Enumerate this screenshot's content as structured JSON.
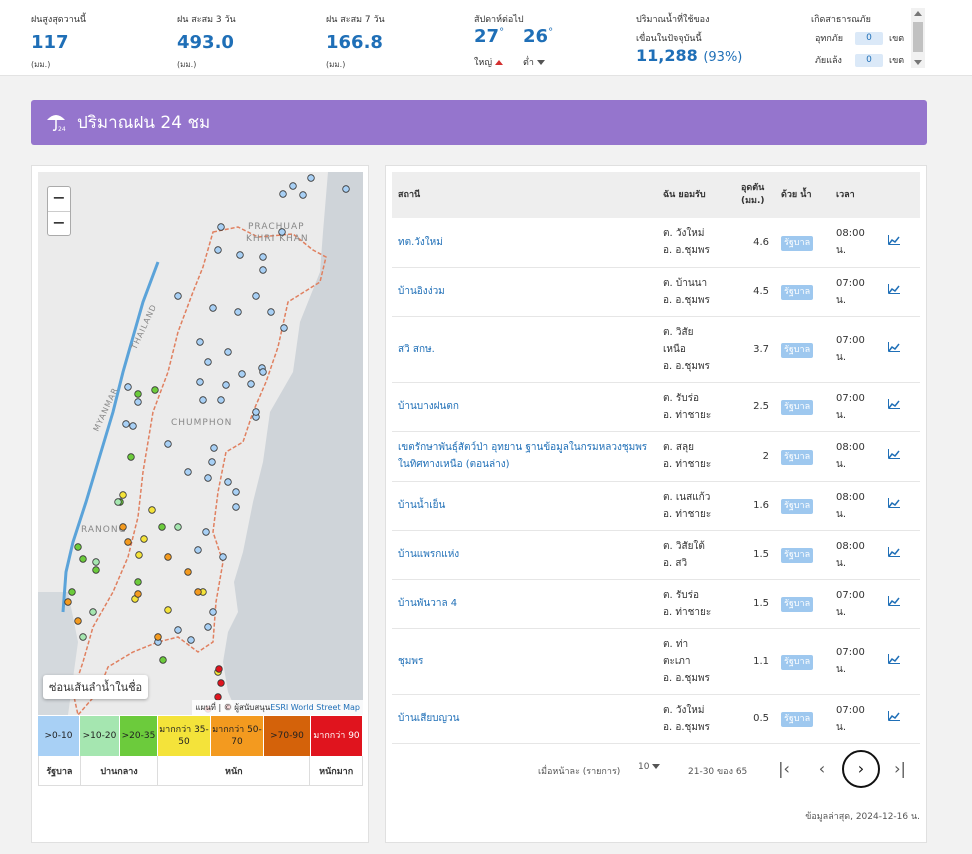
{
  "top": {
    "max_rain": {
      "label": "ฝนสูงสุดวานนี้",
      "value": "117",
      "unit": "(มม.)"
    },
    "acc3": {
      "label": "ฝน สะสม 3 วัน",
      "value": "493.0",
      "unit": "(มม.)"
    },
    "acc7": {
      "label": "ฝน สะสม 7 วัน",
      "value": "166.8",
      "unit": "(มม.)"
    },
    "temp": {
      "label": "สัปดาห์ต่อไป",
      "high": "27",
      "low": "26",
      "deg": "°",
      "high_caption": "ใหญ่",
      "low_caption": "ต่ำ"
    },
    "dam": {
      "label_line1": "ปริมาณน้ำที่ใช้ของ",
      "label_line2": "เขื่อนในปัจจุบันนี้",
      "value": "11,288",
      "pct": "(93%)"
    },
    "disaster": {
      "label": "เกิดสาธารณภัย",
      "flood_label": "อุทกภัย",
      "flood_count": "0",
      "drought_label": "ภัยแล้ง",
      "drought_count": "0",
      "unit": "เขต"
    }
  },
  "header": {
    "title": "ปริมาณฝน 24 ชม"
  },
  "map": {
    "zoom_in": "−",
    "zoom_out": "−",
    "river_button": "ซ่อนเส้นลำน้ำในชื่อ",
    "attribution_prefix": "แผนที่ | © ผู้สนับสนุน",
    "attribution_link": "ESRI World Street Map",
    "place_labels": [
      "PRACHUAP",
      "KHIRI KHAN",
      "CHUMPHON",
      "RANONG",
      "MYANMAR",
      "THAILAND"
    ]
  },
  "legend": {
    "bins": [
      {
        "label": ">0-10",
        "color": "#a8d0f5"
      },
      {
        "label": ">10-20",
        "color": "#a5e6b0"
      },
      {
        "label": ">20-35",
        "color": "#6ccb3c"
      },
      {
        "label": "มากกว่า 35-50",
        "color": "#f4e33a"
      },
      {
        "label": "มากกว่า 50-70",
        "color": "#f39a1f"
      },
      {
        "label": ">70-90",
        "color": "#d4620a"
      },
      {
        "label": "มากกว่า 90",
        "color": "#e0141e"
      }
    ],
    "categories": [
      "รัฐบาล",
      "ปานกลาง",
      "หนัก",
      "หนักมาก"
    ]
  },
  "table": {
    "headers": {
      "station": "สถานี",
      "location": "ฉัน ยอมรับ",
      "rain": "อุดตัน (มม.)",
      "agency": "ด้วย น้ำ",
      "time": "เวลา"
    },
    "rows": [
      {
        "station": "ทต.วังใหม่",
        "loc1": "ต. วังใหม่",
        "loc2": "อ. อ.ชุมพร",
        "loc3": "",
        "rain": "4.6",
        "agency": "รัฐบาล",
        "time1": "08:00",
        "time2": "น."
      },
      {
        "station": "บ้านอิงง่วม",
        "loc1": "ต. บ้านนา",
        "loc2": "อ. อ.ชุมพร",
        "loc3": "",
        "rain": "4.5",
        "agency": "รัฐบาล",
        "time1": "07:00",
        "time2": "น."
      },
      {
        "station": "สวิ สกษ.",
        "loc1": "ต. วิสัย",
        "loc2": "เหนือ",
        "loc3": "อ. อ.ชุมพร",
        "rain": "3.7",
        "agency": "รัฐบาล",
        "time1": "07:00",
        "time2": "น."
      },
      {
        "station": "บ้านบางฝนตก",
        "loc1": "ต. รับร่อ",
        "loc2": "อ. ท่าชายะ",
        "loc3": "",
        "rain": "2.5",
        "agency": "รัฐบาล",
        "time1": "07:00",
        "time2": "น."
      },
      {
        "station": "เขตรักษาพันธุ์สัตว์ป่า อุทยาน ฐานข้อมูลในกรมหลวงชุมพรในทิศทางเหนือ (ตอนล่าง)",
        "loc1": "ต. สลุย",
        "loc2": "อ. ท่าชายะ",
        "loc3": "",
        "rain": "2",
        "agency": "รัฐบาล",
        "time1": "08:00",
        "time2": "น."
      },
      {
        "station": "บ้านน้ำเย็น",
        "loc1": "ต. เนสแก้ว",
        "loc2": "อ. ท่าชายะ",
        "loc3": "",
        "rain": "1.6",
        "agency": "รัฐบาล",
        "time1": "08:00",
        "time2": "น."
      },
      {
        "station": "บ้านแพรกแห่ง",
        "loc1": "ต. วิสัยใต้",
        "loc2": "อ. สวิ",
        "loc3": "",
        "rain": "1.5",
        "agency": "รัฐบาล",
        "time1": "08:00",
        "time2": "น."
      },
      {
        "station": "บ้านพันวาล 4",
        "loc1": "ต. รับร่อ",
        "loc2": "อ. ท่าชายะ",
        "loc3": "",
        "rain": "1.5",
        "agency": "รัฐบาล",
        "time1": "07:00",
        "time2": "น."
      },
      {
        "station": "ชุมพร",
        "loc1": "ต. ท่า",
        "loc2": "ตะเภา",
        "loc3": "อ. อ.ชุมพร",
        "rain": "1.1",
        "agency": "รัฐบาล",
        "time1": "07:00",
        "time2": "น."
      },
      {
        "station": "บ้านเสียบญวน",
        "loc1": "ต. วังใหม่",
        "loc2": "อ. อ.ชุมพร",
        "loc3": "",
        "rain": "0.5",
        "agency": "รัฐบาล",
        "time1": "07:00",
        "time2": "น."
      }
    ],
    "pager": {
      "per_page_label": "เมื่อหน้าละ (รายการ)",
      "per_page": "10",
      "range": "21-30 ของ 65",
      "first": "|‹",
      "prev": "‹",
      "next": "›",
      "last": "›|"
    },
    "updated": "ข้อมูลล่าสุด, 2024-12-16 น."
  },
  "colors": {
    "accent": "#1f6fb7",
    "header_bg": "#9575cd",
    "badge": "#9ec8ef"
  }
}
